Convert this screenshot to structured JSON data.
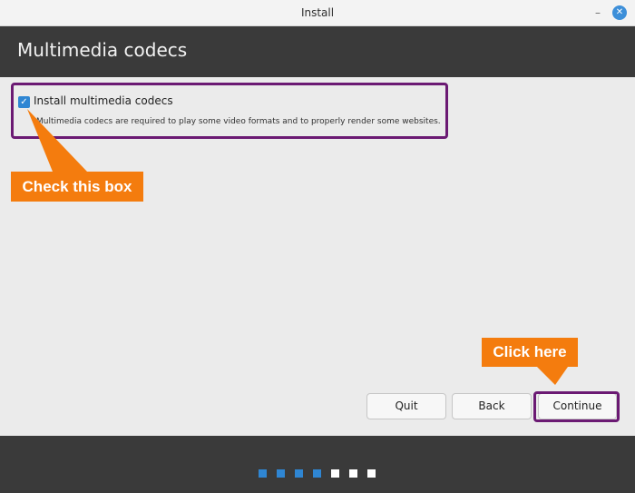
{
  "window": {
    "title": "Install",
    "minimize_glyph": "–",
    "close_glyph": "✕"
  },
  "header": {
    "title": "Multimedia codecs"
  },
  "main": {
    "checkbox": {
      "label": "Install multimedia codecs",
      "checked": true,
      "check_glyph": "✓"
    },
    "description": "Multimedia codecs are required to play some video formats and to properly render some websites."
  },
  "annotations": {
    "check_callout": "Check this box",
    "click_callout": "Click here",
    "callout_color": "#f47c0e",
    "highlight_color": "#6b1a73"
  },
  "buttons": {
    "quit": "Quit",
    "back": "Back",
    "continue": "Continue"
  },
  "progress": {
    "total_steps": 7,
    "completed_steps": 4,
    "completed_color": "#2f86d3",
    "pending_color": "#ffffff"
  }
}
